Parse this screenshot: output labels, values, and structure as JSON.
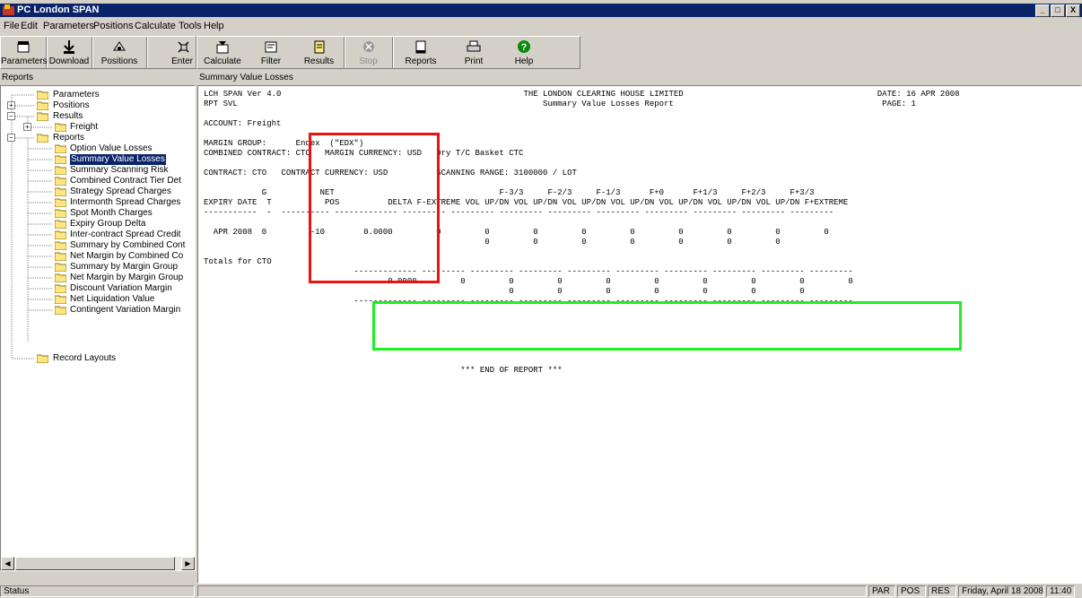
{
  "window": {
    "title": "PC London SPAN",
    "controls": [
      "_",
      "□",
      "X"
    ]
  },
  "menu": [
    "File",
    "Edit",
    "Parameters",
    "Positions",
    "Calculate",
    "Tools",
    "Help"
  ],
  "toolbar": {
    "group1": [
      {
        "label": "Parameters",
        "icon": "parameters-icon"
      },
      {
        "label": "Download",
        "icon": "download-icon"
      },
      {
        "label": "Positions",
        "icon": "positions-icon"
      },
      {
        "label": "Enter",
        "icon": "enter-icon"
      }
    ],
    "group2": [
      {
        "label": "Calculate",
        "icon": "calculate-icon"
      },
      {
        "label": "Filter",
        "icon": "filter-icon"
      },
      {
        "label": "Results",
        "icon": "results-icon"
      },
      {
        "label": "Stop",
        "icon": "stop-icon",
        "disabled": true
      },
      {
        "label": "Reports",
        "icon": "reports-icon"
      },
      {
        "label": "Print",
        "icon": "print-icon"
      },
      {
        "label": "Help",
        "icon": "help-icon"
      }
    ]
  },
  "left_pane": {
    "header": "Reports",
    "tree": {
      "parameters": "Parameters",
      "positions": "Positions",
      "results": "Results",
      "freight": "Freight",
      "reports": "Reports",
      "report_items": [
        "Option Value Losses",
        "Summary Value Losses",
        "Summary Scanning Risk",
        "Combined Contract Tier Det",
        "Strategy Spread Charges",
        "Intermonth Spread Charges",
        "Spot Month Charges",
        "Expiry Group Delta",
        "Inter-contract Spread Credit",
        "Summary by Combined Cont",
        "Net Margin by Combined Co",
        "Summary by Margin Group",
        "Net Margin by Margin Group",
        "Discount Variation Margin",
        "Net Liquidation Value",
        "Contingent Variation Margin"
      ],
      "selected_index": 1,
      "record_layouts": "Record Layouts"
    }
  },
  "right_pane": {
    "header": "Summary Value Losses",
    "report_lines": [
      "LCH SPAN Ver 4.0                                                  THE LONDON CLEARING HOUSE LIMITED                                        DATE: 16 APR 2008",
      "RPT SVL                                                               Summary Value Losses Report                                           PAGE: 1",
      "",
      "ACCOUNT: Freight",
      "",
      "MARGIN GROUP:      Endex  (\"EDX\")",
      "COMBINED CONTRACT: CTC   MARGIN CURRENCY: USD   Dry T/C Basket CTC",
      "",
      "CONTRACT: CTO   CONTRACT CURRENCY: USD          SCANNING RANGE: 3100000 / LOT",
      "",
      "            G           NET                                  F-3/3     F-2/3     F-1/3      F+0      F+1/3     F+2/3     F+3/3",
      "EXPIRY DATE  T           POS          DELTA F-EXTREME VOL UP/DN VOL UP/DN VOL UP/DN VOL UP/DN VOL UP/DN VOL UP/DN VOL UP/DN F+EXTREME",
      "-----------  -  ---------- ------------- --------- --------- --------- --------- --------- --------- --------- --------- ---------",
      "",
      "  APR 2008  0         -10        0.0000         0         0         0         0         0         0         0         0         0",
      "                                                          0         0         0         0         0         0         0",
      "",
      "Totals for CTO",
      "                               ------------- --------- --------- --------- --------- --------- --------- --------- --------- ---------",
      "                                      0.0000         0         0         0         0         0         0         0         0         0",
      "                                                               0         0         0         0         0         0         0",
      "                               ------------- --------- --------- --------- --------- --------- --------- --------- --------- ---------",
      "",
      "",
      "",
      "",
      "",
      "",
      "                                                     *** END OF REPORT ***"
    ]
  },
  "statusbar": {
    "status": "Status",
    "par": "PAR",
    "pos": "POS",
    "res": "RES",
    "date": "Friday, April 18 2008",
    "time": "11:40"
  }
}
